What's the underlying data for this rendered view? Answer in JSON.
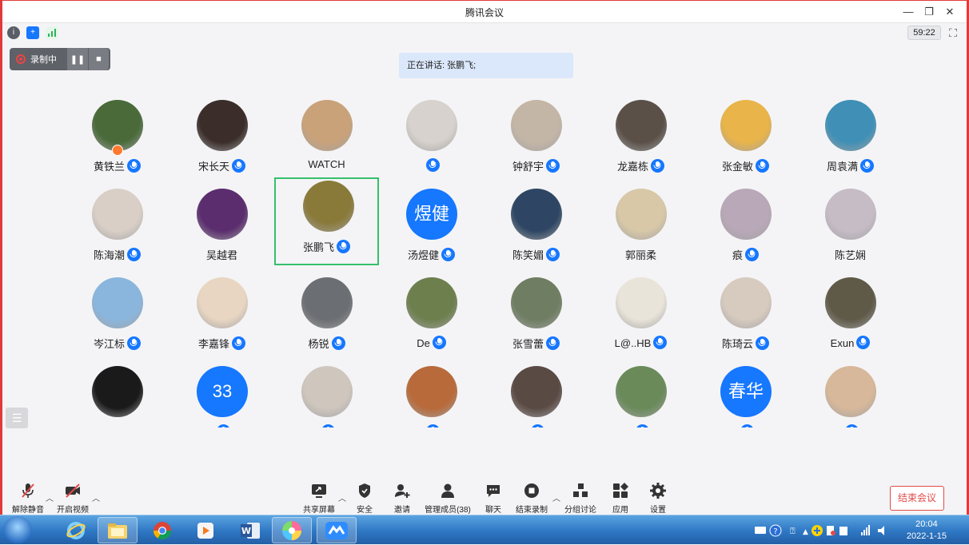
{
  "window": {
    "title": "腾讯会议",
    "minimize_glyph": "—",
    "restore_glyph": "❐",
    "close_glyph": "✕"
  },
  "infobar": {
    "timer": "59:22",
    "icons": [
      "info-icon",
      "shield-icon",
      "signal-icon"
    ]
  },
  "recording": {
    "label": "录制中"
  },
  "speaking": {
    "text": "正在讲话: 张鹏飞;"
  },
  "participants": [
    {
      "name": "黄铁兰",
      "mic": true,
      "host": true,
      "avatar_color": "#4a6a3a"
    },
    {
      "name": "宋长天",
      "mic": true,
      "avatar_color": "#3a2d2a"
    },
    {
      "name": "WATCH",
      "mic": false,
      "avatar_color": "#c9a27a"
    },
    {
      "name": "",
      "mic": true,
      "avatar_color": "#d7d2cd"
    },
    {
      "name": "钟舒宇",
      "mic": true,
      "avatar_color": "#c4b6a6"
    },
    {
      "name": "龙嘉栋",
      "mic": true,
      "avatar_color": "#5a5048"
    },
    {
      "name": "张金敏",
      "mic": true,
      "avatar_color": "#e9b44a"
    },
    {
      "name": "周袁满",
      "mic": true,
      "avatar_color": "#3f8fb6"
    },
    {
      "name": "陈海潮",
      "mic": true,
      "avatar_color": "#d9cfc7"
    },
    {
      "name": "吴越君",
      "mic": false,
      "avatar_color": "#5b2d6e"
    },
    {
      "name": "张鹏飞",
      "mic": true,
      "active": true,
      "avatar_color": "#8a7a3a"
    },
    {
      "name": "汤煜健",
      "mic": true,
      "avatar_text": "煜健"
    },
    {
      "name": "陈笑媚",
      "mic": true,
      "avatar_color": "#2e4663"
    },
    {
      "name": "郭丽柔",
      "mic": false,
      "avatar_color": "#d8c8a8"
    },
    {
      "name": "痕",
      "mic": true,
      "avatar_color": "#b9a8b8"
    },
    {
      "name": "陈艺娴",
      "mic": false,
      "avatar_color": "#c6bcc6"
    },
    {
      "name": "岑江标",
      "mic": true,
      "avatar_color": "#8ab6dd"
    },
    {
      "name": "李嘉锋",
      "mic": true,
      "avatar_color": "#e8d6c2"
    },
    {
      "name": "杨锐",
      "mic": true,
      "avatar_color": "#6b6e72"
    },
    {
      "name": "De",
      "mic": true,
      "avatar_color": "#6e7f4e"
    },
    {
      "name": "张雪蕾",
      "mic": true,
      "avatar_color": "#6f7d62"
    },
    {
      "name": "L@..HB",
      "mic": true,
      "avatar_color": "#e9e4d9"
    },
    {
      "name": "陈琦云",
      "mic": true,
      "avatar_color": "#d7cbbf"
    },
    {
      "name": "Exun",
      "mic": true,
      "avatar_color": "#5f5a48"
    },
    {
      "name": "",
      "mic": false,
      "avatar_color": "#1a1a1a"
    },
    {
      "name": "",
      "mic": true,
      "avatar_text": "33"
    },
    {
      "name": "",
      "mic": true,
      "avatar_color": "#cfc7be"
    },
    {
      "name": "",
      "mic": true,
      "avatar_color": "#b86a3a"
    },
    {
      "name": "",
      "mic": true,
      "avatar_color": "#5a4a44"
    },
    {
      "name": "",
      "mic": true,
      "avatar_color": "#6a8a5a"
    },
    {
      "name": "",
      "mic": true,
      "avatar_text": "春华"
    },
    {
      "name": "",
      "mic": true,
      "avatar_color": "#d8b89a"
    }
  ],
  "toolbar": {
    "unmute": "解除静音",
    "start_video": "开启视频",
    "share_screen": "共享屏幕",
    "security": "安全",
    "invite": "邀请",
    "manage_members": "管理成员(38)",
    "chat": "聊天",
    "end_recording": "结束录制",
    "breakout": "分组讨论",
    "apps": "应用",
    "settings": "设置",
    "end_meeting": "结束会议"
  },
  "taskbar": {
    "time": "20:04",
    "date": "2022-1-15",
    "apps": [
      "ie-icon",
      "file-explorer-icon",
      "chrome-icon",
      "media-player-icon",
      "word-icon",
      "color-app-icon",
      "tencent-meeting-icon"
    ]
  },
  "colors": {
    "accent": "#1677ff",
    "active_border": "#35c06b",
    "end_red": "#e24a4a"
  }
}
